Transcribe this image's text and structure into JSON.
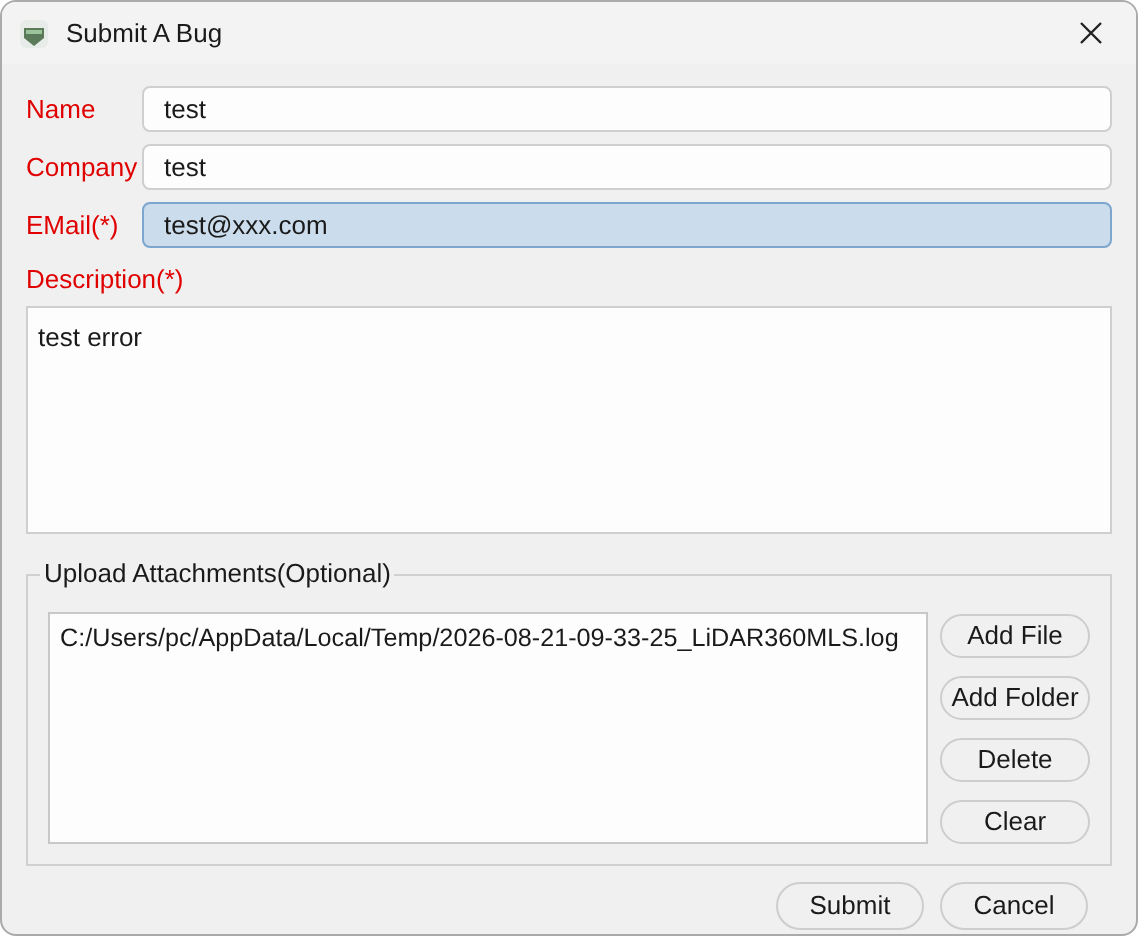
{
  "window": {
    "title": "Submit A Bug"
  },
  "fields": [
    {
      "label": "Name",
      "value": "test",
      "focused": false
    },
    {
      "label": "Company",
      "value": "test",
      "focused": false
    },
    {
      "label": "EMail(*)",
      "value": "test@xxx.com",
      "focused": true
    }
  ],
  "description": {
    "label": "Description(*)",
    "value": "test error"
  },
  "attachments": {
    "title": "Upload Attachments(Optional)",
    "files": [
      "C:/Users/pc/AppData/Local/Temp/2026-08-21-09-33-25_LiDAR360MLS.log"
    ],
    "buttons": [
      "Add File",
      "Add Folder",
      "Delete",
      "Clear"
    ]
  },
  "buttons": [
    "Submit",
    "Cancel"
  ]
}
